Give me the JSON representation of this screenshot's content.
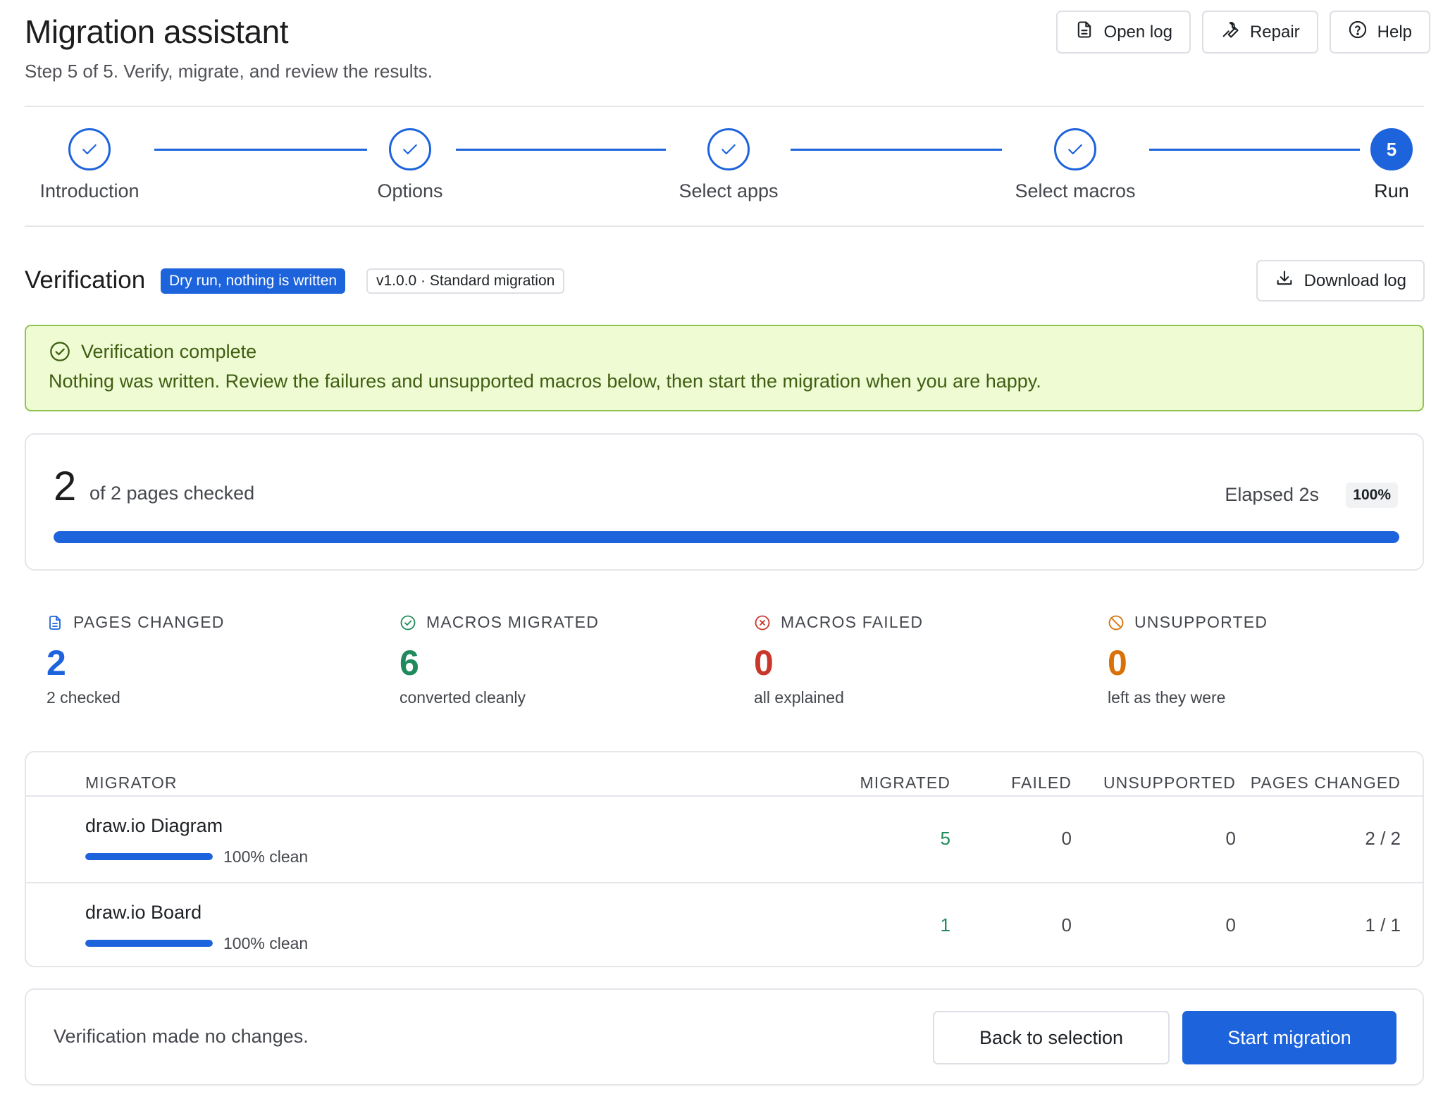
{
  "header": {
    "title": "Migration assistant",
    "subtitle": "Step 5 of 5. Verify, migrate, and review the results.",
    "actions": [
      {
        "label": "Open log",
        "icon": "file-icon"
      },
      {
        "label": "Repair",
        "icon": "wrench-icon"
      },
      {
        "label": "Help",
        "icon": "help-icon"
      }
    ]
  },
  "stepper": {
    "steps": [
      {
        "label": "Introduction",
        "state": "done"
      },
      {
        "label": "Options",
        "state": "done"
      },
      {
        "label": "Select apps",
        "state": "done"
      },
      {
        "label": "Select macros",
        "state": "done"
      },
      {
        "label": "Run",
        "state": "active",
        "number": "5"
      }
    ]
  },
  "verification": {
    "title": "Verification",
    "badge_mode": "Dry run, nothing is written",
    "badge_version": "v1.0.0 · Standard migration",
    "download_label": "Download log"
  },
  "alert": {
    "title": "Verification complete",
    "body": "Nothing was written. Review the failures and unsupported macros below, then start the migration when you are happy."
  },
  "progress": {
    "checked": "2",
    "of_text": "of 2 pages checked",
    "elapsed": "Elapsed 2s",
    "percent_label": "100%",
    "fraction": 1.0
  },
  "stats": [
    {
      "label": "PAGES CHANGED",
      "value": "2",
      "sub": "2 checked",
      "color": "#1d63dc",
      "icon": "page-icon"
    },
    {
      "label": "MACROS MIGRATED",
      "value": "6",
      "sub": "converted cleanly",
      "color": "#1f8a5b",
      "icon": "check-circle-icon"
    },
    {
      "label": "MACROS FAILED",
      "value": "0",
      "sub": "all explained",
      "color": "#c9372c",
      "icon": "x-circle-icon"
    },
    {
      "label": "UNSUPPORTED",
      "value": "0",
      "sub": "left as they were",
      "color": "#d97008",
      "icon": "ban-icon"
    }
  ],
  "table": {
    "headers": {
      "migrator": "MIGRATOR",
      "migrated": "MIGRATED",
      "failed": "FAILED",
      "unsupported": "UNSUPPORTED",
      "pages": "PAGES CHANGED"
    },
    "rows": [
      {
        "name": "draw.io Diagram",
        "clean": "100% clean",
        "clean_fraction": 1.0,
        "migrated": "5",
        "failed": "0",
        "unsupported": "0",
        "pages": "2 / 2"
      },
      {
        "name": "draw.io Board",
        "clean": "100% clean",
        "clean_fraction": 1.0,
        "migrated": "1",
        "failed": "0",
        "unsupported": "0",
        "pages": "1 / 1"
      }
    ]
  },
  "footer": {
    "text": "Verification made no changes.",
    "back_label": "Back to selection",
    "start_label": "Start migration"
  }
}
